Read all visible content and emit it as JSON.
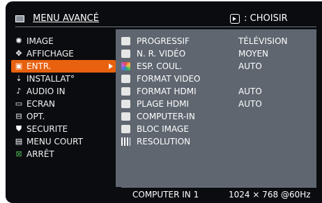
{
  "header": {
    "title": "MENU AVANCÉ",
    "choose_label": ": CHOISIR"
  },
  "left_menu": [
    {
      "label": "IMAGE",
      "icon": "brightness-icon",
      "active": false
    },
    {
      "label": "AFFICHAGE",
      "icon": "display-icon",
      "active": false
    },
    {
      "label": "ENTR.",
      "icon": "input-icon",
      "active": true
    },
    {
      "label": "INSTALLAT°",
      "icon": "setup-icon",
      "active": false
    },
    {
      "label": "AUDIO IN",
      "icon": "audio-note-icon",
      "active": false
    },
    {
      "label": "ECRAN",
      "icon": "screen-icon",
      "active": false
    },
    {
      "label": "OPT.",
      "icon": "option-icon",
      "active": false
    },
    {
      "label": "SECURITE",
      "icon": "security-icon",
      "active": false
    },
    {
      "label": "MENU COURT",
      "icon": "short-menu-icon",
      "active": false
    },
    {
      "label": "ARRÊT",
      "icon": "exit-icon",
      "active": false
    }
  ],
  "right_menu": [
    {
      "label": "PROGRESSIF",
      "value": "TÉLÉVISION",
      "icon": "progressive-icon"
    },
    {
      "label": "N. R. VIDÉO",
      "value": "MOYEN",
      "icon": "video-nr-icon"
    },
    {
      "label": "ESP. COUL.",
      "value": "AUTO",
      "icon": "color-space-icon"
    },
    {
      "label": "FORMAT VIDEO",
      "value": "",
      "icon": "video-format-icon"
    },
    {
      "label": "FORMAT HDMI",
      "value": "AUTO",
      "icon": "hdmi-format-icon"
    },
    {
      "label": "PLAGE HDMI",
      "value": "AUTO",
      "icon": "hdmi-range-icon"
    },
    {
      "label": "COMPUTER-IN",
      "value": "",
      "icon": "computer-in-icon"
    },
    {
      "label": "BLOC IMAGE",
      "value": "",
      "icon": "frame-lock-icon"
    },
    {
      "label": "RESOLUTION",
      "value": "",
      "icon": "resolution-icon"
    }
  ],
  "footer": {
    "source": "COMPUTER IN 1",
    "resolution": "1024 × 768 @60Hz"
  },
  "colors": {
    "background": "#0b0c10",
    "panel": "#5f6670",
    "highlight": "#e8610f",
    "text": "#ffffff"
  }
}
